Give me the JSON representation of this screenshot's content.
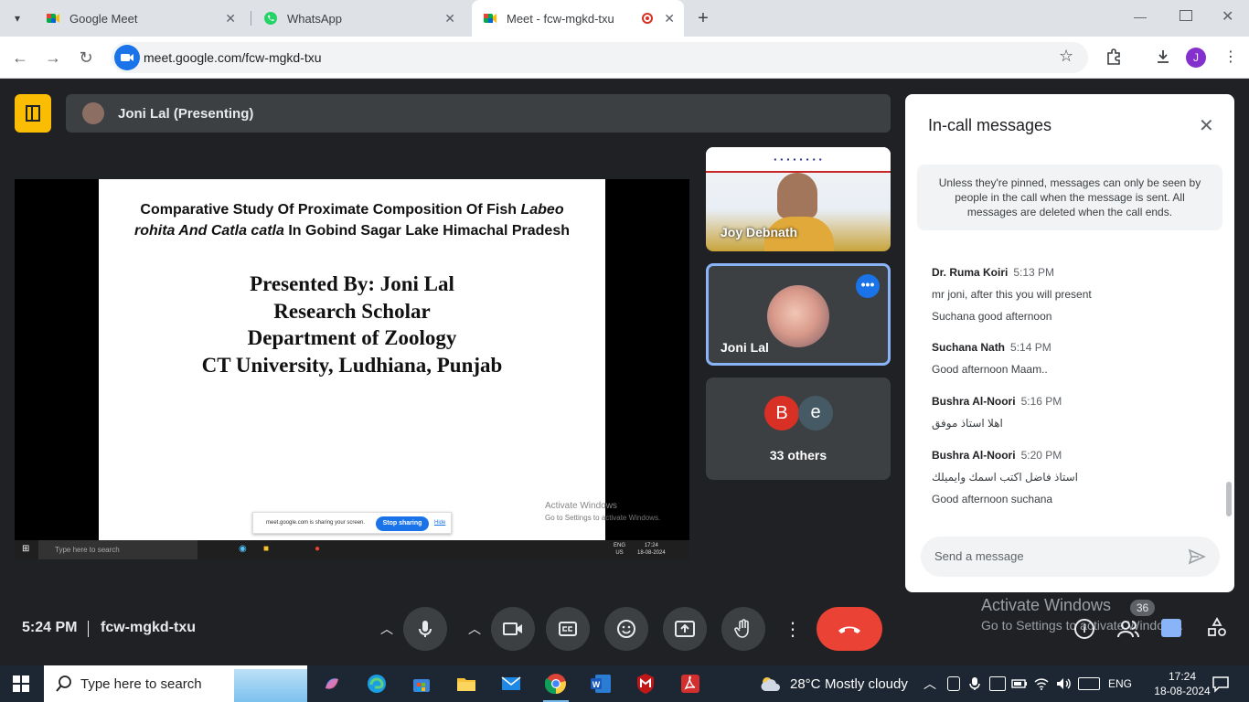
{
  "browser": {
    "tabs": [
      {
        "title": "Google Meet",
        "active": false
      },
      {
        "title": "WhatsApp",
        "active": false
      },
      {
        "title": "Meet - fcw-mgkd-txu",
        "active": true
      }
    ],
    "url": "meet.google.com/fcw-mgkd-txu",
    "profile_initial": "J"
  },
  "meet": {
    "presenting_label": "Joni Lal (Presenting)",
    "slide": {
      "title_line1_a": "Comparative Study Of Proximate Composition Of Fish ",
      "title_line1_b": "Labeo",
      "title_line2_a": "rohita And Catla catla",
      "title_line2_b": "  In Gobind Sagar Lake Himachal Pradesh",
      "line1": "Presented By: Joni Lal",
      "line2": "Research Scholar",
      "line3": "Department of Zoology",
      "line4": "CT University, Ludhiana, Punjab"
    },
    "inner_share_bar": {
      "text": "meet.google.com is sharing your screen.",
      "stop": "Stop sharing",
      "hide": "Hide"
    },
    "inner_taskbar": {
      "search": "Type here to search",
      "lang1": "ENG",
      "lang2": "US",
      "time": "17:24",
      "date": "18-08-2024"
    },
    "inner_watermark": {
      "line1": "Activate Windows",
      "line2": "Go to Settings to activate Windows."
    },
    "participants": [
      {
        "name": "Joy Debnath"
      },
      {
        "name": "Joni Lal"
      }
    ],
    "others": {
      "avatar1": "B",
      "avatar2": "e",
      "label": "33 others"
    },
    "meeting_time": "5:24 PM",
    "meeting_code": "fcw-mgkd-txu",
    "participant_count": "36"
  },
  "chat": {
    "title": "In-call messages",
    "notice": "Unless they're pinned, messages can only be seen by people in the call when the message is sent. All messages are deleted when the call ends.",
    "messages": [
      {
        "name": "Dr. Ruma Koiri",
        "time": "5:13 PM",
        "lines": [
          "mr joni, after this you will present",
          "Suchana good afternoon"
        ]
      },
      {
        "name": "Suchana Nath",
        "time": "5:14 PM",
        "lines": [
          "Good afternoon Maam.."
        ]
      },
      {
        "name": "Bushra Al-Noori",
        "time": "5:16 PM",
        "lines": [
          "اهلا استاذ موفق"
        ]
      },
      {
        "name": "Bushra Al-Noori",
        "time": "5:20 PM",
        "lines": [
          "استاذ فاضل  اكتب اسمك وايميلك",
          "Good afternoon  suchana"
        ]
      }
    ],
    "input_placeholder": "Send a message"
  },
  "watermark": {
    "line1": "Activate Windows",
    "line2": "Go to Settings to activate Windows."
  },
  "taskbar": {
    "search_placeholder": "Type here to search",
    "weather_temp": "28°C",
    "weather_desc": "Mostly cloudy",
    "lang": "ENG",
    "time": "17:24",
    "date": "18-08-2024"
  },
  "colors": {
    "end_call": "#ea4335",
    "accent_blue": "#8ab4f8",
    "meet_bg": "#202124",
    "tile_bg": "#3c4043"
  }
}
